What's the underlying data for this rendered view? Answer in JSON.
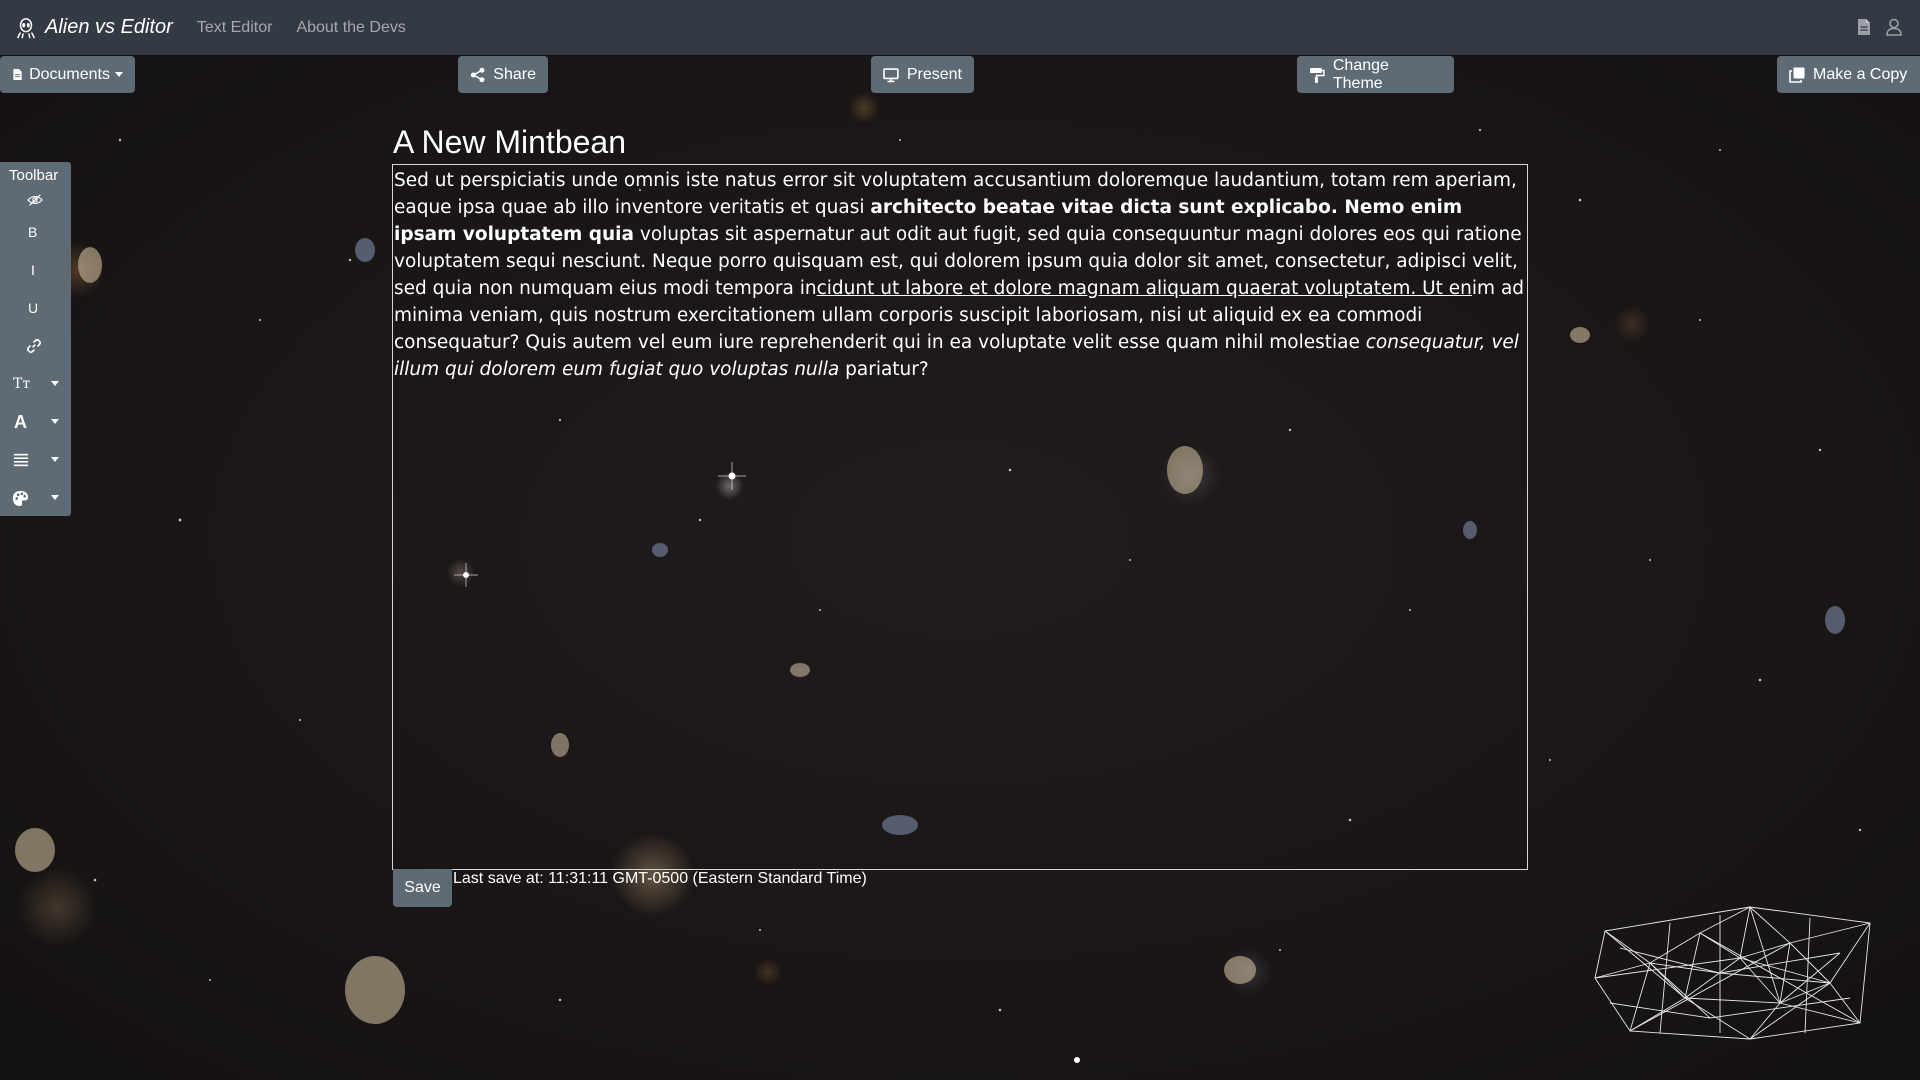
{
  "app": {
    "brand": "Alien vs Editor",
    "brand_icon": "alien-icon"
  },
  "nav": {
    "links": [
      "Text Editor",
      "About the Devs"
    ],
    "right_icons": [
      "document-icon",
      "user-icon"
    ]
  },
  "actions": {
    "documents": "Documents",
    "share": "Share",
    "present": "Present",
    "change_theme": "Change Theme",
    "make_copy": "Make a Copy"
  },
  "document": {
    "title": "A New Mintbean",
    "body": {
      "p1": "Sed ut perspiciatis unde omnis iste natus error sit voluptatem accusantium doloremque laudantium, totam rem aperiam, eaque ipsa quae ab illo inventore veritatis et quasi ",
      "bold": "architecto beatae vitae dicta sunt explicabo. Nemo enim ipsam voluptatem quia",
      "p2": " voluptas sit aspernatur aut odit aut fugit, sed quia consequuntur magni dolores eos qui ratione voluptatem sequi nesciunt. Neque porro quisquam est, qui dolorem ipsum quia dolor sit amet, consectetur, adipisci velit, sed quia non numquam eius modi tempora in",
      "underline": "cidunt ut labore et dolore magnam aliquam quaerat voluptatem. Ut en",
      "p3": "im ad minima veniam, quis nostrum exercitationem ullam corporis suscipit laboriosam, nisi ut aliquid ex ea commodi consequatur? Quis autem vel eum iure reprehenderit qui in ea voluptate velit esse quam nihil molestiae ",
      "italic": "consequatur, vel illum qui dolorem eum fugiat quo voluptas nulla",
      "p4": " pariatur?"
    }
  },
  "toolbar": {
    "label": "Toolbar",
    "items": {
      "hide": "eye-slash-icon",
      "bold": "B",
      "italic": "I",
      "underline": "U",
      "link": "link-icon",
      "text_size": "Tт",
      "font_color": "A",
      "align": "align-icon",
      "palette": "palette-icon"
    }
  },
  "footer": {
    "save": "Save",
    "last_save": "Last save at: 11:31:11 GMT-0500 (Eastern Standard Time)"
  },
  "colors": {
    "navbar": "#343a44",
    "button": "#5f6b74",
    "nav_link": "#a5a9ae"
  }
}
